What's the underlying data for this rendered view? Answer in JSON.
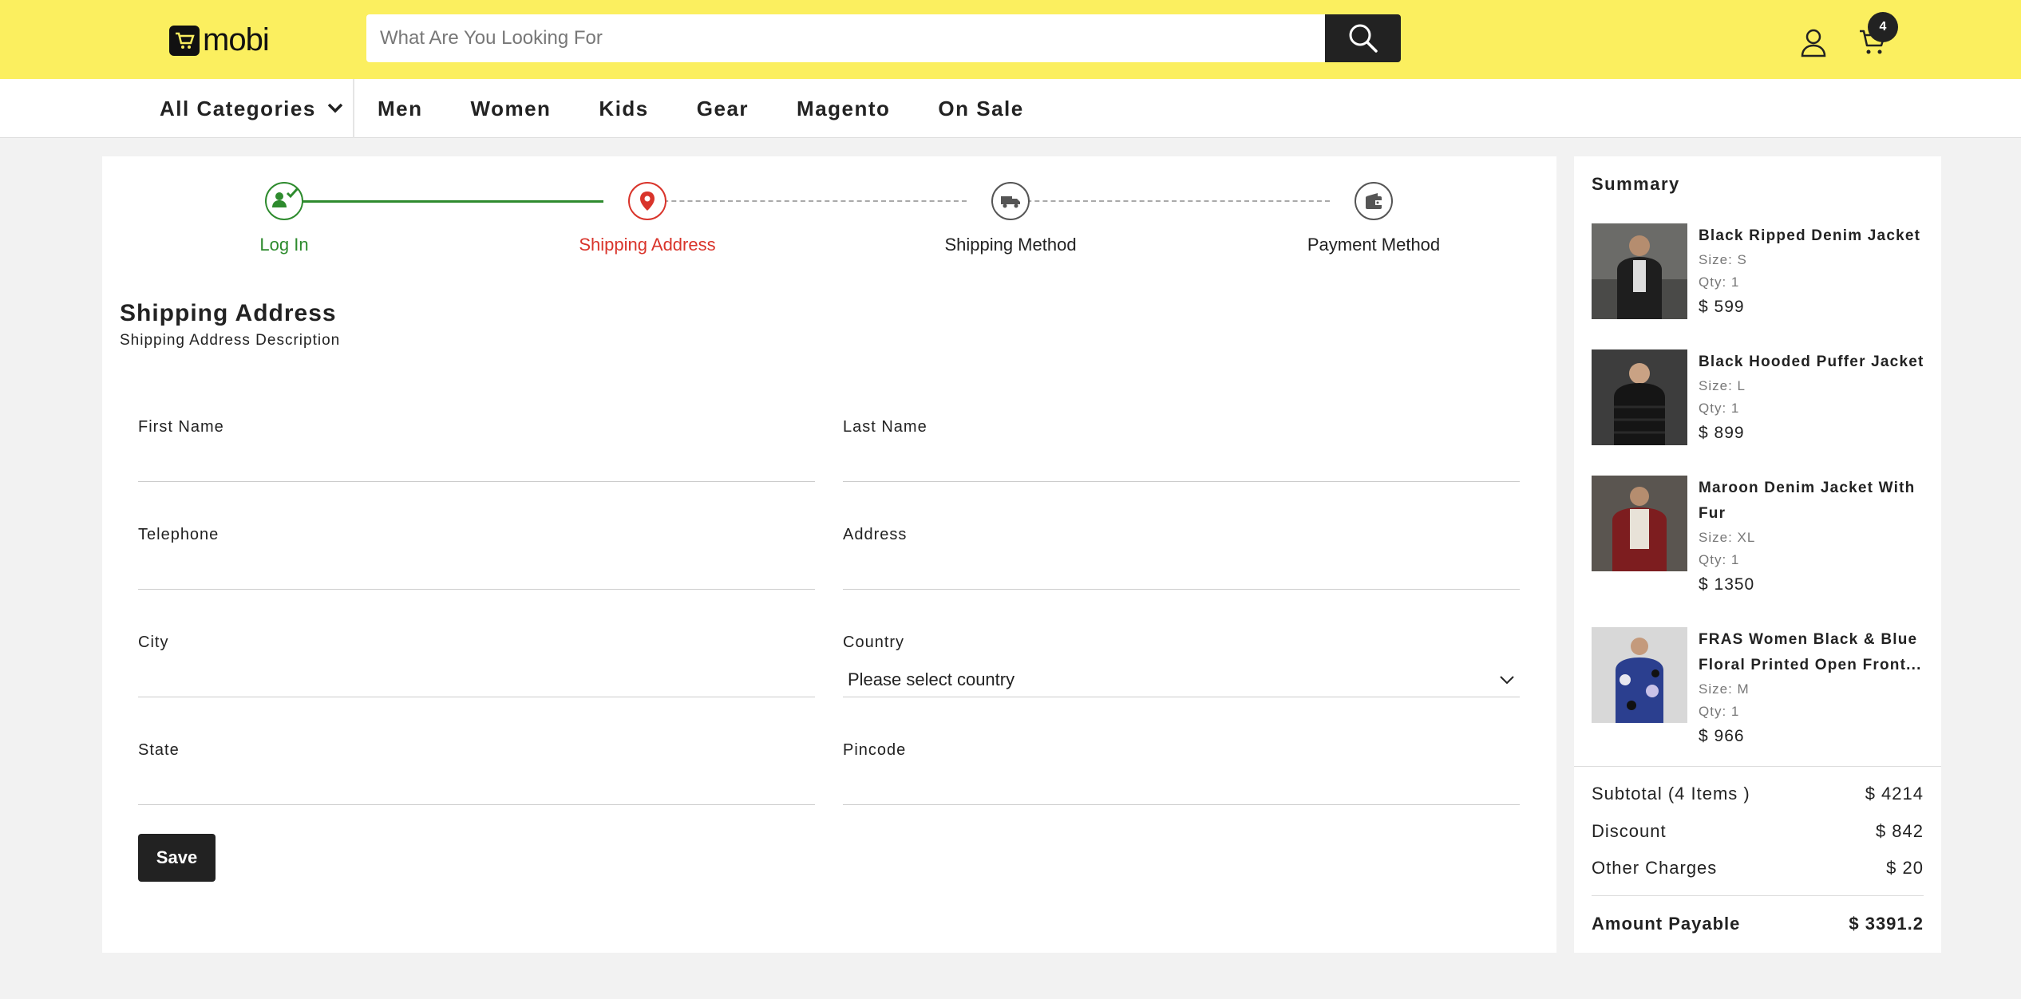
{
  "header": {
    "logo_text": "mobi",
    "search_placeholder": "What Are You Looking For",
    "cart_count": "4"
  },
  "nav": {
    "all_categories": "All Categories",
    "items": [
      "Men",
      "Women",
      "Kids",
      "Gear",
      "Magento",
      "On Sale"
    ]
  },
  "steps": [
    {
      "label": "Log In",
      "state": "done",
      "icon": "user-check-icon"
    },
    {
      "label": "Shipping Address",
      "state": "active",
      "icon": "location-pin-icon"
    },
    {
      "label": "Shipping Method",
      "state": "pending",
      "icon": "truck-icon"
    },
    {
      "label": "Payment Method",
      "state": "pending",
      "icon": "wallet-icon"
    }
  ],
  "form": {
    "title": "Shipping Address",
    "description": "Shipping Address Description",
    "first_name_label": "First Name",
    "last_name_label": "Last Name",
    "telephone_label": "Telephone",
    "address_label": "Address",
    "city_label": "City",
    "country_label": "Country",
    "country_value": "Please select country",
    "state_label": "State",
    "pincode_label": "Pincode",
    "save_label": "Save"
  },
  "summary": {
    "title": "Summary",
    "items": [
      {
        "name": "Black Ripped Denim Jacket",
        "size": "Size: S",
        "qty": "Qty: 1",
        "price": "$ 599"
      },
      {
        "name": "Black Hooded Puffer Jacket",
        "size": "Size: L",
        "qty": "Qty: 1",
        "price": "$ 899"
      },
      {
        "name": "Maroon Denim Jacket With Fur",
        "size": "Size: XL",
        "qty": "Qty: 1",
        "price": "$ 1350"
      },
      {
        "name": "FRAS Women Black & Blue Floral Printed Open Front...",
        "size": "Size: M",
        "qty": "Qty: 1",
        "price": "$ 966"
      }
    ],
    "subtotal_label": "Subtotal (4 Items )",
    "subtotal_value": "$ 4214",
    "discount_label": "Discount",
    "discount_value": "$ 842",
    "other_label": "Other Charges",
    "other_value": "$ 20",
    "payable_label": "Amount Payable",
    "payable_value": "$ 3391.2"
  },
  "colors": {
    "header_bg": "#fbef5f",
    "done": "#2e8b2e",
    "active": "#d9342b",
    "dark": "#222222"
  }
}
